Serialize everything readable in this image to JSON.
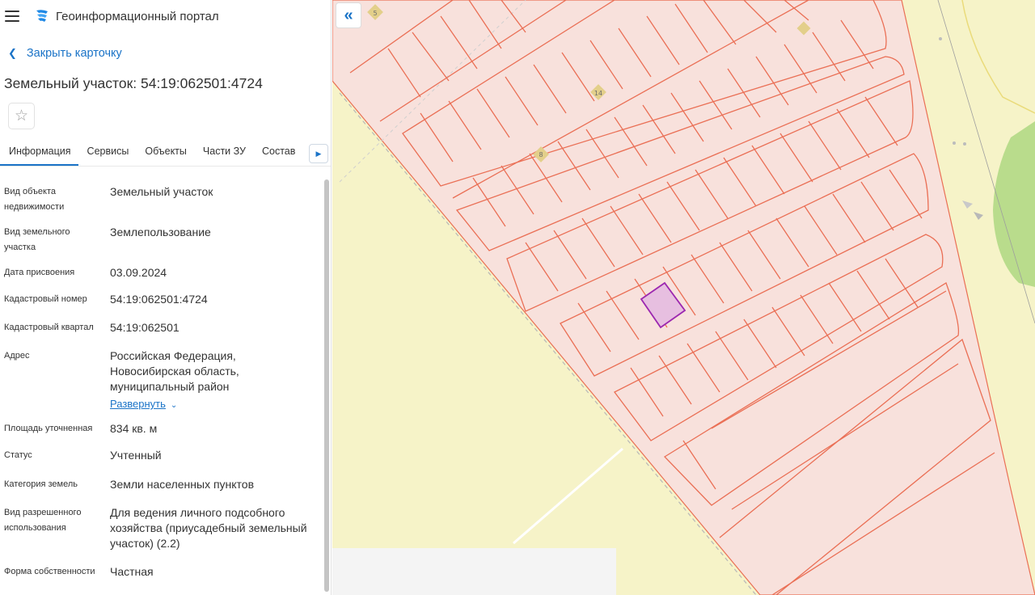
{
  "app": {
    "title": "Геоинформационный портал"
  },
  "card": {
    "close_label": "Закрыть карточку",
    "title": "Земельный участок: 54:19:062501:4724"
  },
  "tabs": [
    "Информация",
    "Сервисы",
    "Объекты",
    "Части ЗУ",
    "Состав"
  ],
  "props": [
    {
      "label": "Вид объекта недвижимости",
      "value": "Земельный участок"
    },
    {
      "label": "Вид земельного участка",
      "value": "Землепользование"
    },
    {
      "label": "Дата присвоения",
      "value": "03.09.2024"
    },
    {
      "label": "Кадастровый номер",
      "value": "54:19:062501:4724"
    },
    {
      "label": "Кадастровый квартал",
      "value": "54:19:062501"
    },
    {
      "label": "Адрес",
      "value": "Российская Федерация, Новосибирская область, муниципальный район"
    },
    {
      "label": "Площадь уточненная",
      "value": "834 кв. м"
    },
    {
      "label": "Статус",
      "value": "Учтенный"
    },
    {
      "label": "Категория земель",
      "value": "Земли населенных пунктов"
    },
    {
      "label": "Вид разрешенного использования",
      "value": "Для ведения личного подсобного хозяйства (приусадебный земельный участок) (2.2)"
    },
    {
      "label": "Форма собственности",
      "value": "Частная"
    }
  ],
  "address_expand_label": "Развернуть",
  "map": {
    "markers": [
      "5",
      "14",
      "8"
    ],
    "colors": {
      "parcel_fill": "#f8e1dc",
      "parcel_stroke": "#ea6f55",
      "selected_fill": "#e7bfe0",
      "selected_stroke": "#9c27b0",
      "background": "#f6f3c8",
      "forest": "#b9dc8c"
    }
  }
}
